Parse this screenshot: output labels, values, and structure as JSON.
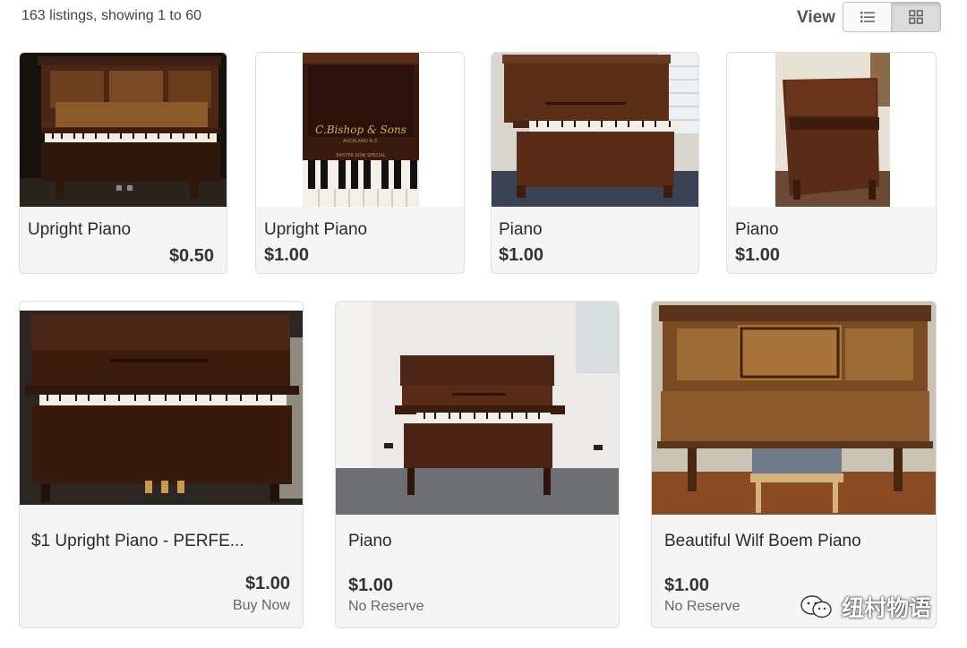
{
  "header": {
    "listing_count": "163 listings, showing 1 to 60",
    "view_label": "View",
    "view_modes": {
      "list_icon": "list-icon",
      "grid_icon": "grid-icon",
      "selected": "grid"
    }
  },
  "listings": [
    {
      "title": "Upright Piano",
      "price": "$0.50",
      "sub": ""
    },
    {
      "title": "Upright Piano",
      "price": "$1.00",
      "sub": ""
    },
    {
      "title": "Piano",
      "price": "$1.00",
      "sub": ""
    },
    {
      "title": "Piano",
      "price": "$1.00",
      "sub": ""
    },
    {
      "title": "$1 Upright Piano - PERFE...",
      "price": "$1.00",
      "sub": "Buy Now"
    },
    {
      "title": "Piano",
      "price": "$1.00",
      "sub": "No Reserve"
    },
    {
      "title": "Beautiful Wilf Boem Piano",
      "price": "$1.00",
      "sub": "No Reserve"
    }
  ],
  "photo_text": {
    "maker_plate": "C.Bishop & Sons",
    "maker_city": "AUCKLAND N.Z.",
    "maker_model": "EASTER SOW SPECIAL"
  },
  "watermark": {
    "icon": "wechat-icon",
    "text": "纽村物语"
  },
  "colors": {
    "card_bg": "#f5f5f5",
    "card_border": "#dedede",
    "price_text": "#333333",
    "toggle_active": "#dcdcdc"
  }
}
